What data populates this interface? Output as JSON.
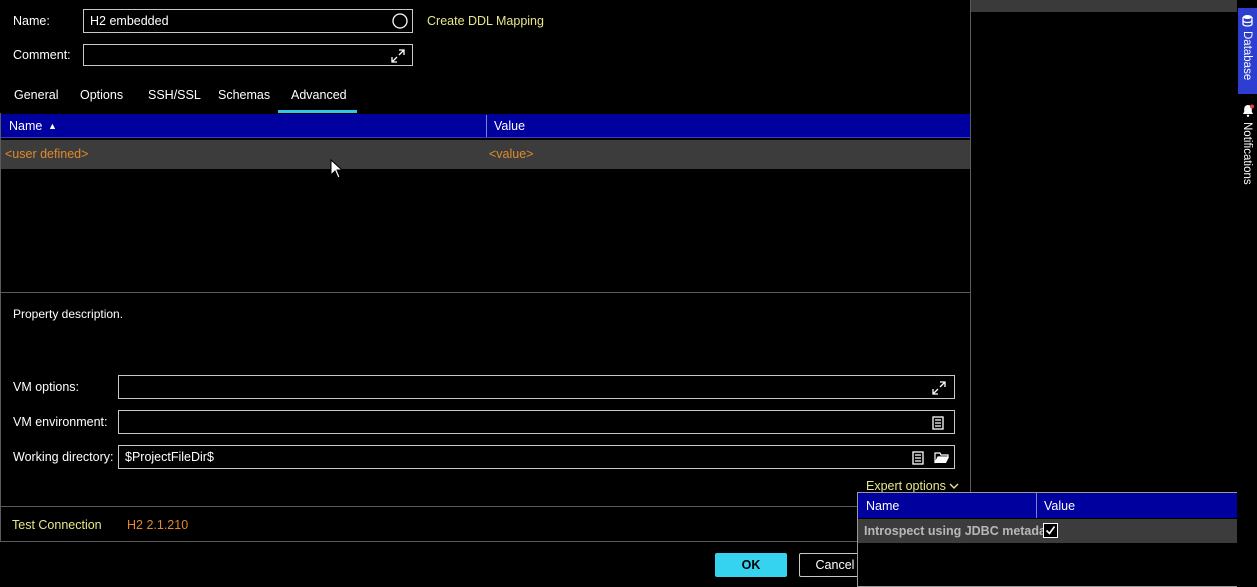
{
  "form": {
    "name_label": "Name:",
    "name_value": "H2 embedded",
    "comment_label": "Comment:",
    "comment_value": "",
    "ddl_link": "Create DDL Mapping"
  },
  "tabs": [
    {
      "label": "General"
    },
    {
      "label": "Options"
    },
    {
      "label": "SSH/SSL"
    },
    {
      "label": "Schemas"
    },
    {
      "label": "Advanced"
    }
  ],
  "active_tab": "Advanced",
  "table": {
    "col_name": "Name",
    "col_value": "Value",
    "sort_indicator": "▲",
    "rows": [
      {
        "name": "<user defined>",
        "value": "<value>"
      }
    ]
  },
  "description": "Property description.",
  "vm": {
    "options_label": "VM options:",
    "options_value": "",
    "environment_label": "VM environment:",
    "environment_value": "",
    "workdir_label": "Working directory:",
    "workdir_value": "$ProjectFileDir$"
  },
  "expert_options": "Expert options",
  "footer": {
    "test_connection": "Test Connection",
    "driver_version": "H2 2.1.210"
  },
  "buttons": {
    "ok": "OK",
    "cancel": "Cancel"
  },
  "popup": {
    "col_name": "Name",
    "col_value": "Value",
    "row_name": "Introspect using JDBC metadat",
    "row_checked": true
  },
  "sidebar": {
    "database": "Database",
    "notifications": "Notifications"
  },
  "colors": {
    "accent": "#35c7e6",
    "header_blue": "#00009e",
    "link_yellow": "#e7e78a",
    "placeholder_orange": "#e08a2a"
  },
  "icons": [
    "expand-icon",
    "circle-icon",
    "list-icon",
    "folder-icon",
    "chevron-down-icon",
    "checkbox-icon",
    "database-icon",
    "bell-icon",
    "mouse-cursor-icon"
  ]
}
